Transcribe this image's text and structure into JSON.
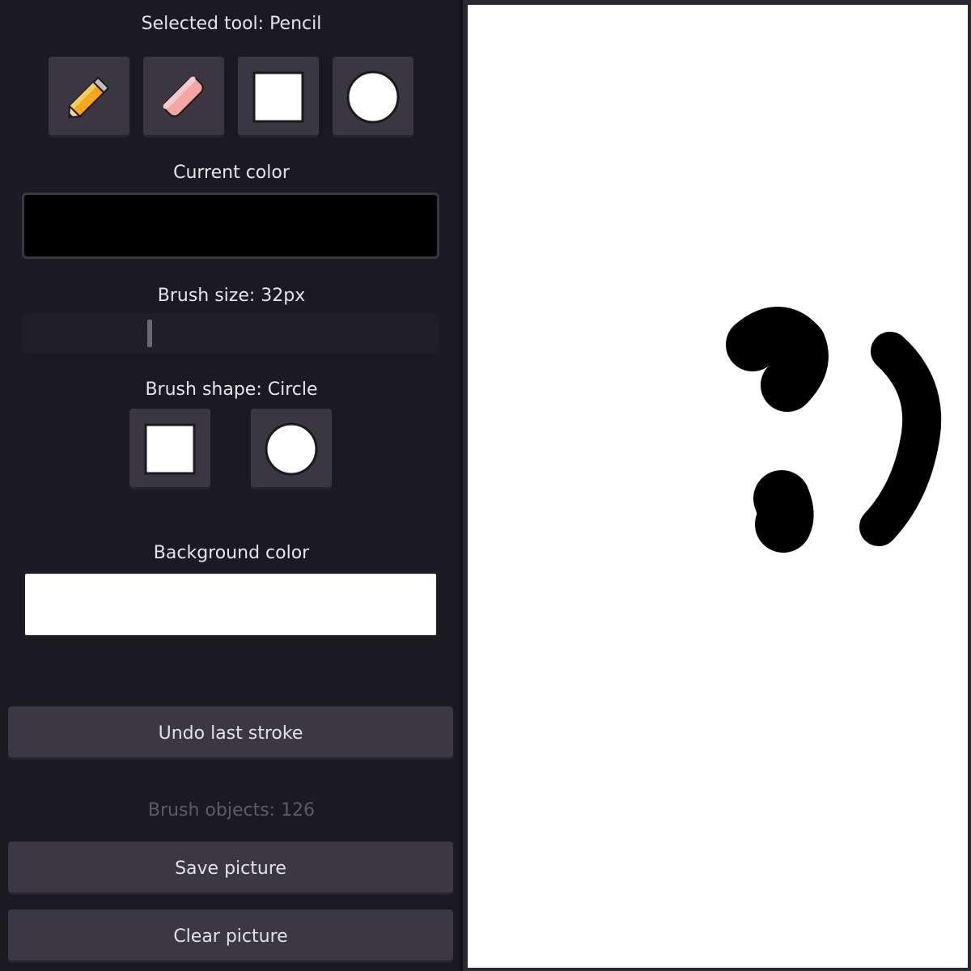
{
  "sidebar": {
    "selected_tool_label": "Selected tool: Pencil",
    "tools": [
      {
        "name": "pencil"
      },
      {
        "name": "eraser"
      },
      {
        "name": "rectangle"
      },
      {
        "name": "circle"
      }
    ],
    "current_color_label": "Current color",
    "current_color": "#000000",
    "brush_size_label": "Brush size: 32px",
    "brush_size_px": 32,
    "brush_size_fraction": 0.3,
    "brush_shape_label": "Brush shape: Circle",
    "brush_shapes": [
      {
        "name": "square"
      },
      {
        "name": "circle"
      }
    ],
    "background_color_label": "Background color",
    "background_color": "#ffffff",
    "undo_label": "Undo last stroke",
    "brush_objects_label": "Brush objects: 126",
    "save_label": "Save picture",
    "clear_label": "Clear picture"
  },
  "colors": {
    "panel_bg": "#1b1a20",
    "button_bg": "#3b3744",
    "canvas_bg": "#ffffff",
    "stroke": "#000000",
    "pencil_body": "#f5a623",
    "eraser_body": "#f4a6a6"
  }
}
